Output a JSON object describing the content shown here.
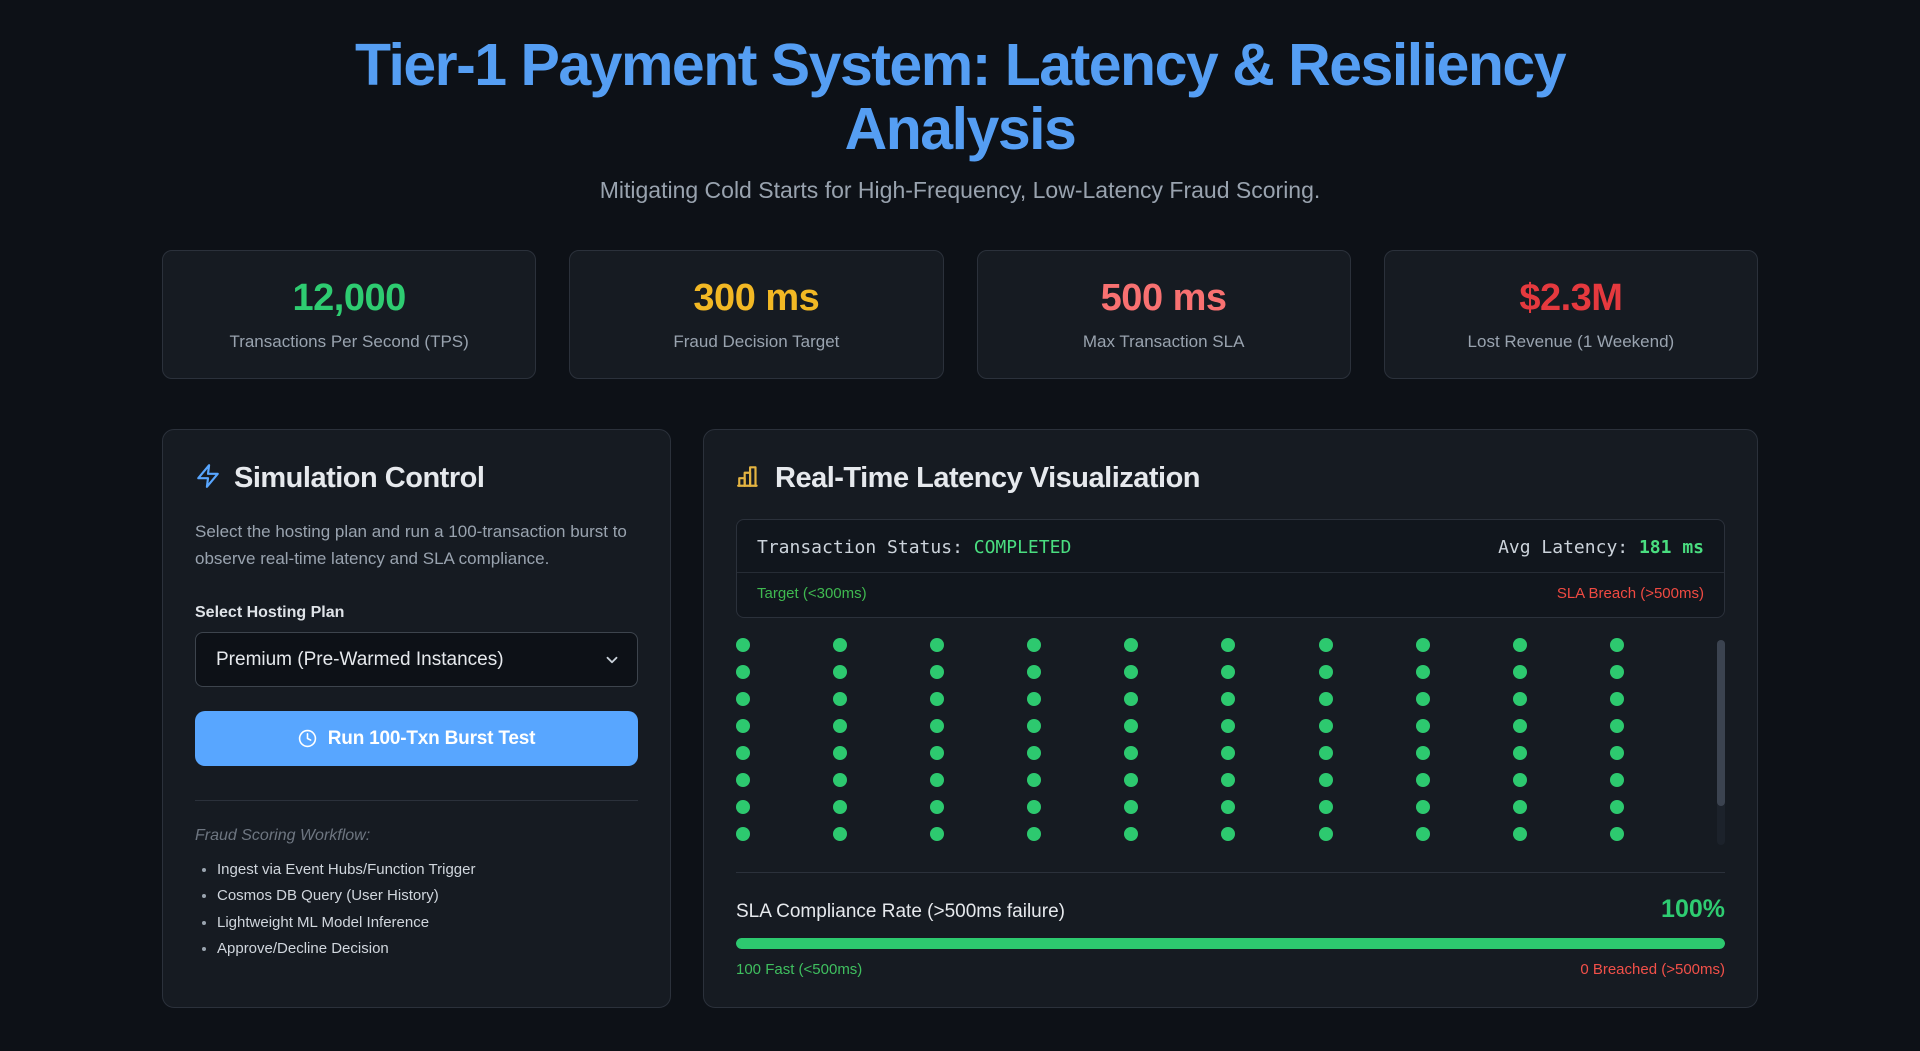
{
  "page": {
    "title": "Tier-1 Payment System: Latency & Resiliency Analysis",
    "subtitle": "Mitigating Cold Starts for High-Frequency, Low-Latency Fraud Scoring."
  },
  "colors": {
    "accent_blue": "#58a6ff",
    "title_blue": "#559ef3",
    "success_green": "#2ecc71",
    "dot_green": "#2dc96f",
    "status_green": "#4ade80",
    "warning_yellow": "#f2b824",
    "salmon_red": "#f87171",
    "danger_red": "#e5393e",
    "breach_red": "#f04a42",
    "panel_bg": "#161b22",
    "page_bg": "#0d1117"
  },
  "stats": [
    {
      "value": "12,000",
      "label": "Transactions Per Second (TPS)",
      "color": "green"
    },
    {
      "value": "300 ms",
      "label": "Fraud Decision Target",
      "color": "yellow"
    },
    {
      "value": "500 ms",
      "label": "Max Transaction SLA",
      "color": "salmon"
    },
    {
      "value": "$2.3M",
      "label": "Lost Revenue (1 Weekend)",
      "color": "red"
    }
  ],
  "simulation": {
    "icon": "lightning-bolt-icon",
    "title": "Simulation Control",
    "description": "Select the hosting plan and run a 100-transaction burst to observe real-time latency and SLA compliance.",
    "hosting_label": "Select Hosting Plan",
    "hosting_selected": "Premium (Pre-Warmed Instances)",
    "run_button_label": "Run 100-Txn Burst Test",
    "workflow_title": "Fraud Scoring Workflow:",
    "workflow_steps": [
      "Ingest via Event Hubs/Function Trigger",
      "Cosmos DB Query (User History)",
      "Lightweight ML Model Inference",
      "Approve/Decline Decision"
    ]
  },
  "visualization": {
    "icon": "bar-chart-icon",
    "title": "Real-Time Latency Visualization",
    "status_label": "Transaction Status:",
    "status_value": "COMPLETED",
    "avg_latency_label": "Avg Latency:",
    "avg_latency_value": "181 ms",
    "target_label": "Target (<300ms)",
    "breach_label": "SLA Breach (>500ms)",
    "dots": {
      "columns": 10,
      "visible_rows": 8,
      "total_transactions": 100,
      "state": "fast"
    },
    "sla": {
      "label": "SLA Compliance Rate (>500ms failure)",
      "value": "100%",
      "progress_percent": 100,
      "fast_label": "100 Fast (<500ms)",
      "breached_label": "0 Breached (>500ms)"
    }
  }
}
